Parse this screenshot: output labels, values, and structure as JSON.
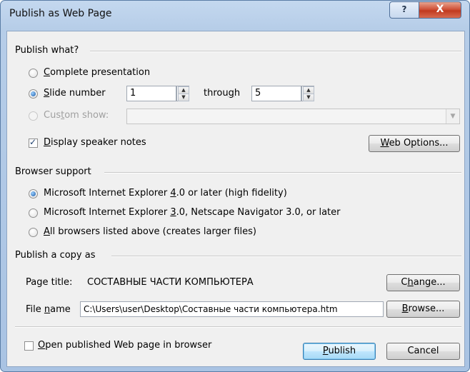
{
  "window": {
    "title": "Publish as Web Page",
    "help_glyph": "?",
    "close_glyph": "X"
  },
  "publish_what": {
    "heading": "Publish what?",
    "complete_presentation": {
      "prefix": "",
      "mnemonic": "C",
      "rest": "omplete presentation",
      "selected": false
    },
    "slide_number": {
      "prefix": "",
      "mnemonic": "S",
      "rest": "lide number",
      "selected": true
    },
    "from_value": "1",
    "through_prefix": "throu",
    "through_mnemonic": "g",
    "through_rest": "h",
    "to_value": "5",
    "custom_show": {
      "prefix": "Cus",
      "mnemonic": "t",
      "rest": "om show:",
      "selected": false,
      "enabled": false
    },
    "custom_show_value": "",
    "display_notes": {
      "prefix": "",
      "mnemonic": "D",
      "rest": "isplay speaker notes",
      "checked": true
    },
    "web_options": {
      "prefix": "",
      "mnemonic": "W",
      "rest": "eb Options..."
    }
  },
  "browser_support": {
    "heading": "Browser support",
    "options": [
      {
        "prefix": "Microsoft Internet Explorer ",
        "mnemonic": "4",
        "rest": ".0 or later (high fidelity)",
        "selected": true
      },
      {
        "prefix": "Microsoft Internet Explorer ",
        "mnemonic": "3",
        "rest": ".0, Netscape Navigator 3.0, or later",
        "selected": false
      },
      {
        "prefix": "",
        "mnemonic": "A",
        "rest": "ll browsers listed above (creates larger files)",
        "selected": false
      }
    ]
  },
  "publish_copy": {
    "heading": "Publish a copy as",
    "page_title_label": "Page title:",
    "page_title_value": "СОСТАВНЫЕ ЧАСТИ КОМПЬЮТЕРА",
    "change": {
      "prefix": "C",
      "mnemonic": "h",
      "rest": "ange..."
    },
    "file_name_prefix": "File ",
    "file_name_mnemonic": "n",
    "file_name_rest": "ame",
    "file_name_value": "C:\\Users\\user\\Desktop\\Составные части компьютера.htm",
    "browse": {
      "prefix": "",
      "mnemonic": "B",
      "rest": "rowse..."
    }
  },
  "footer": {
    "open_in_browser": {
      "prefix": "",
      "mnemonic": "O",
      "rest": "pen published Web page in browser",
      "checked": false
    },
    "publish": {
      "prefix": "",
      "mnemonic": "P",
      "rest": "ublish"
    },
    "cancel": "Cancel"
  }
}
